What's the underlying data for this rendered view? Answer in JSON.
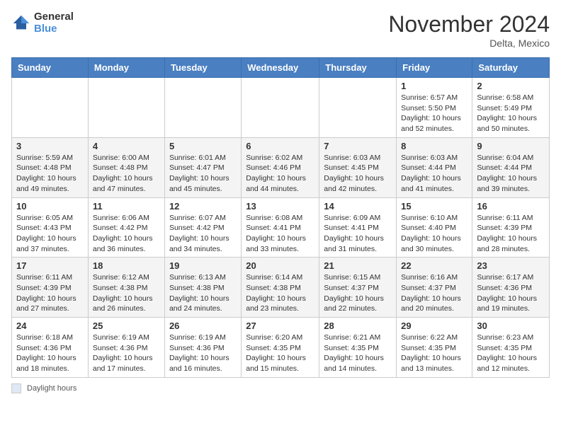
{
  "header": {
    "logo_line1": "General",
    "logo_line2": "Blue",
    "month": "November 2024",
    "location": "Delta, Mexico"
  },
  "days_of_week": [
    "Sunday",
    "Monday",
    "Tuesday",
    "Wednesday",
    "Thursday",
    "Friday",
    "Saturday"
  ],
  "weeks": [
    [
      {
        "day": "",
        "info": ""
      },
      {
        "day": "",
        "info": ""
      },
      {
        "day": "",
        "info": ""
      },
      {
        "day": "",
        "info": ""
      },
      {
        "day": "",
        "info": ""
      },
      {
        "day": "1",
        "info": "Sunrise: 6:57 AM\nSunset: 5:50 PM\nDaylight: 10 hours and 52 minutes."
      },
      {
        "day": "2",
        "info": "Sunrise: 6:58 AM\nSunset: 5:49 PM\nDaylight: 10 hours and 50 minutes."
      }
    ],
    [
      {
        "day": "3",
        "info": "Sunrise: 5:59 AM\nSunset: 4:48 PM\nDaylight: 10 hours and 49 minutes."
      },
      {
        "day": "4",
        "info": "Sunrise: 6:00 AM\nSunset: 4:48 PM\nDaylight: 10 hours and 47 minutes."
      },
      {
        "day": "5",
        "info": "Sunrise: 6:01 AM\nSunset: 4:47 PM\nDaylight: 10 hours and 45 minutes."
      },
      {
        "day": "6",
        "info": "Sunrise: 6:02 AM\nSunset: 4:46 PM\nDaylight: 10 hours and 44 minutes."
      },
      {
        "day": "7",
        "info": "Sunrise: 6:03 AM\nSunset: 4:45 PM\nDaylight: 10 hours and 42 minutes."
      },
      {
        "day": "8",
        "info": "Sunrise: 6:03 AM\nSunset: 4:44 PM\nDaylight: 10 hours and 41 minutes."
      },
      {
        "day": "9",
        "info": "Sunrise: 6:04 AM\nSunset: 4:44 PM\nDaylight: 10 hours and 39 minutes."
      }
    ],
    [
      {
        "day": "10",
        "info": "Sunrise: 6:05 AM\nSunset: 4:43 PM\nDaylight: 10 hours and 37 minutes."
      },
      {
        "day": "11",
        "info": "Sunrise: 6:06 AM\nSunset: 4:42 PM\nDaylight: 10 hours and 36 minutes."
      },
      {
        "day": "12",
        "info": "Sunrise: 6:07 AM\nSunset: 4:42 PM\nDaylight: 10 hours and 34 minutes."
      },
      {
        "day": "13",
        "info": "Sunrise: 6:08 AM\nSunset: 4:41 PM\nDaylight: 10 hours and 33 minutes."
      },
      {
        "day": "14",
        "info": "Sunrise: 6:09 AM\nSunset: 4:41 PM\nDaylight: 10 hours and 31 minutes."
      },
      {
        "day": "15",
        "info": "Sunrise: 6:10 AM\nSunset: 4:40 PM\nDaylight: 10 hours and 30 minutes."
      },
      {
        "day": "16",
        "info": "Sunrise: 6:11 AM\nSunset: 4:39 PM\nDaylight: 10 hours and 28 minutes."
      }
    ],
    [
      {
        "day": "17",
        "info": "Sunrise: 6:11 AM\nSunset: 4:39 PM\nDaylight: 10 hours and 27 minutes."
      },
      {
        "day": "18",
        "info": "Sunrise: 6:12 AM\nSunset: 4:38 PM\nDaylight: 10 hours and 26 minutes."
      },
      {
        "day": "19",
        "info": "Sunrise: 6:13 AM\nSunset: 4:38 PM\nDaylight: 10 hours and 24 minutes."
      },
      {
        "day": "20",
        "info": "Sunrise: 6:14 AM\nSunset: 4:38 PM\nDaylight: 10 hours and 23 minutes."
      },
      {
        "day": "21",
        "info": "Sunrise: 6:15 AM\nSunset: 4:37 PM\nDaylight: 10 hours and 22 minutes."
      },
      {
        "day": "22",
        "info": "Sunrise: 6:16 AM\nSunset: 4:37 PM\nDaylight: 10 hours and 20 minutes."
      },
      {
        "day": "23",
        "info": "Sunrise: 6:17 AM\nSunset: 4:36 PM\nDaylight: 10 hours and 19 minutes."
      }
    ],
    [
      {
        "day": "24",
        "info": "Sunrise: 6:18 AM\nSunset: 4:36 PM\nDaylight: 10 hours and 18 minutes."
      },
      {
        "day": "25",
        "info": "Sunrise: 6:19 AM\nSunset: 4:36 PM\nDaylight: 10 hours and 17 minutes."
      },
      {
        "day": "26",
        "info": "Sunrise: 6:19 AM\nSunset: 4:36 PM\nDaylight: 10 hours and 16 minutes."
      },
      {
        "day": "27",
        "info": "Sunrise: 6:20 AM\nSunset: 4:35 PM\nDaylight: 10 hours and 15 minutes."
      },
      {
        "day": "28",
        "info": "Sunrise: 6:21 AM\nSunset: 4:35 PM\nDaylight: 10 hours and 14 minutes."
      },
      {
        "day": "29",
        "info": "Sunrise: 6:22 AM\nSunset: 4:35 PM\nDaylight: 10 hours and 13 minutes."
      },
      {
        "day": "30",
        "info": "Sunrise: 6:23 AM\nSunset: 4:35 PM\nDaylight: 10 hours and 12 minutes."
      }
    ]
  ],
  "footer": {
    "legend_label": "Daylight hours"
  }
}
